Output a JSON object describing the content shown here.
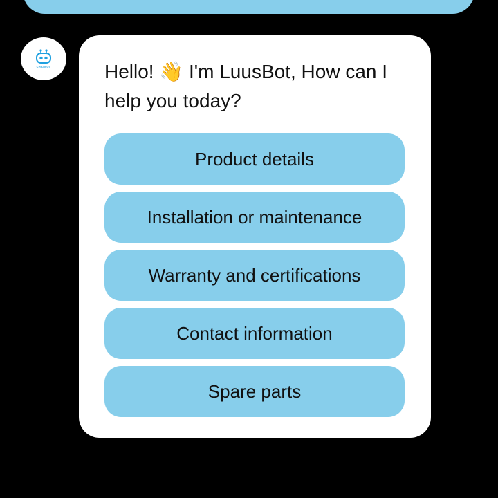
{
  "chat": {
    "bot_avatar": {
      "icon": "robot-icon",
      "label": "CHATBOT"
    },
    "message": {
      "greeting": "Hello! 👋 I'm LuusBot, How can I help you today?"
    },
    "options": [
      {
        "label": "Product details"
      },
      {
        "label": "Installation or maintenance"
      },
      {
        "label": "Warranty and certifications"
      },
      {
        "label": "Contact information"
      },
      {
        "label": "Spare parts"
      }
    ]
  },
  "colors": {
    "background": "#000000",
    "bubble": "#ffffff",
    "option_button": "#87CEEB",
    "accent": "#1ea0e0"
  }
}
